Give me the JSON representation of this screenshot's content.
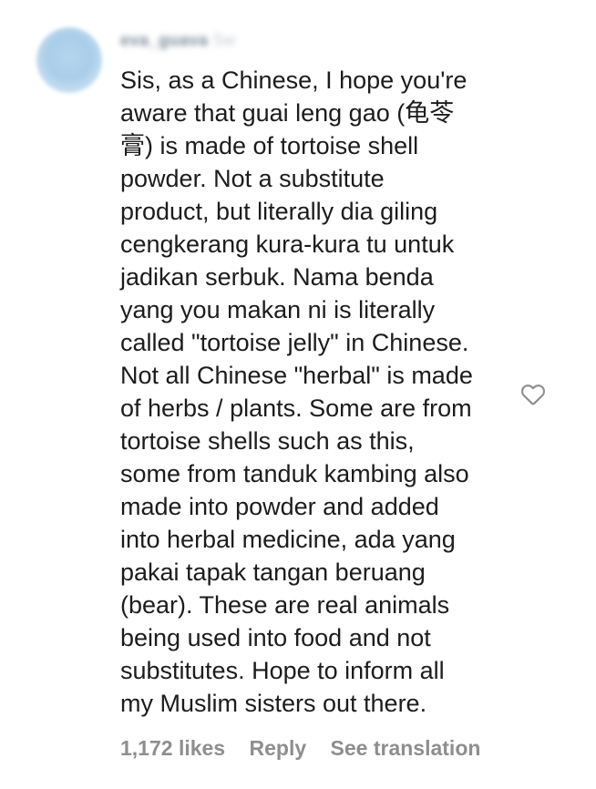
{
  "comment": {
    "username": "eva_guava",
    "time": "5w",
    "lines": [
      "Sis, as a Chinese, I hope you're",
      "aware that guai leng gao (龟苓",
      "膏) is made of tortoise shell",
      "powder. Not a substitute",
      "product, but literally dia giling",
      "cengkerang kura-kura tu untuk",
      "jadikan serbuk. Nama benda",
      "yang you makan ni is literally",
      "called \"tortoise jelly\" in Chinese.",
      "Not all Chinese \"herbal\" is made",
      "of herbs / plants. Some are from",
      "tortoise shells such as this,",
      "some from tanduk kambing also",
      "made into powder and added",
      "into herbal medicine, ada yang",
      "pakai tapak tangan beruang",
      "(bear). These are real animals",
      "being used into food and not",
      "substitutes. Hope to inform all",
      "my Muslim sisters out there."
    ],
    "likes": "1,172 likes",
    "reply_label": "Reply",
    "translation_label": "See translation",
    "like_icon": "heart-outline-icon"
  },
  "colors": {
    "text": "#1c1c1c",
    "muted": "#8e8e8e",
    "avatar": "#a9cde9"
  }
}
